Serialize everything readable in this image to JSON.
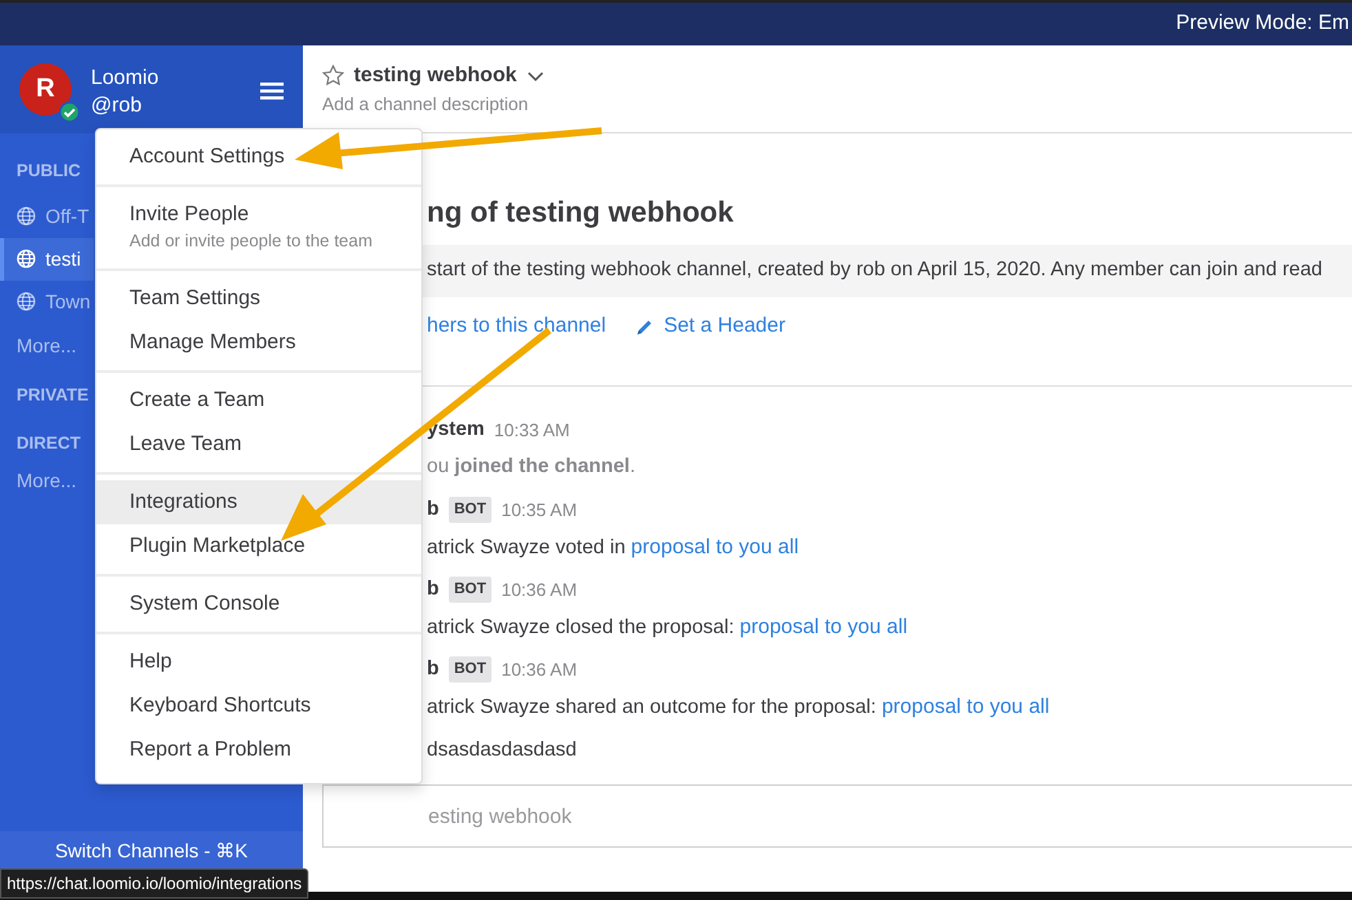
{
  "top_bar": {
    "text": "Preview Mode: Em"
  },
  "sidebar": {
    "avatar_letter": "R",
    "online": true,
    "team_name": "Loomio",
    "username": "@rob",
    "sections": [
      {
        "heading": "PUBLIC",
        "items": [
          {
            "label": "Off-T",
            "selected": false
          },
          {
            "label": "testi",
            "selected": true
          },
          {
            "label": "Town",
            "selected": false
          }
        ],
        "more": "More..."
      },
      {
        "heading": "PRIVATE"
      },
      {
        "heading": "DIRECT",
        "more": "More..."
      }
    ],
    "switch_channels": "Switch Channels - ⌘K"
  },
  "channel_header": {
    "name": "testing webhook",
    "description": "Add a channel description"
  },
  "intro": {
    "title": "ng of testing webhook",
    "text": "start of the testing webhook channel, created by rob on April 15, 2020. Any member can join and read",
    "links": [
      {
        "kind": "plain",
        "label": "hers to this channel"
      },
      {
        "kind": "pencil",
        "label": "Set a Header"
      }
    ]
  },
  "messages": [
    {
      "author": "ystem",
      "time": "10:33 AM",
      "parts": [
        {
          "text": "ou **joined the channel**.",
          "kind": "muted"
        }
      ]
    },
    {
      "author": "b",
      "badge": "BOT",
      "time": "10:35 AM",
      "parts": [
        {
          "text": "atrick Swayze voted in ",
          "kind": "text"
        },
        {
          "text": "proposal to you all",
          "kind": "link"
        }
      ]
    },
    {
      "author": "b",
      "badge": "BOT",
      "time": "10:36 AM",
      "parts": [
        {
          "text": "atrick Swayze closed the proposal: ",
          "kind": "text"
        },
        {
          "text": "proposal to you all",
          "kind": "link"
        }
      ]
    },
    {
      "author": "b",
      "badge": "BOT",
      "time": "10:36 AM",
      "parts": [
        {
          "text": "atrick Swayze shared an outcome for the proposal: ",
          "kind": "text"
        },
        {
          "text": "proposal to you all",
          "kind": "link"
        }
      ]
    },
    {
      "parts": [
        {
          "text": "dsasdasdasdasd",
          "kind": "text"
        }
      ]
    }
  ],
  "composer": {
    "placeholder": "esting webhook"
  },
  "menu": {
    "groups": [
      [
        {
          "label": "Account Settings",
          "selected": false
        }
      ],
      [
        {
          "label": "Invite People",
          "hint": "Add or invite people to the team",
          "selected": false
        }
      ],
      [
        {
          "label": "Team Settings",
          "selected": false
        },
        {
          "label": "Manage Members",
          "selected": false
        }
      ],
      [
        {
          "label": "Create a Team",
          "selected": false
        },
        {
          "label": "Leave Team",
          "selected": false
        }
      ],
      [
        {
          "label": "Integrations",
          "selected": true
        },
        {
          "label": "Plugin Marketplace",
          "selected": false
        }
      ],
      [
        {
          "label": "System Console",
          "selected": false
        }
      ],
      [
        {
          "label": "Help",
          "selected": false
        },
        {
          "label": "Keyboard Shortcuts",
          "selected": false
        },
        {
          "label": "Report a Problem",
          "selected": false
        }
      ]
    ]
  },
  "status_url": "https://chat.loomio.io/loomio/integrations"
}
